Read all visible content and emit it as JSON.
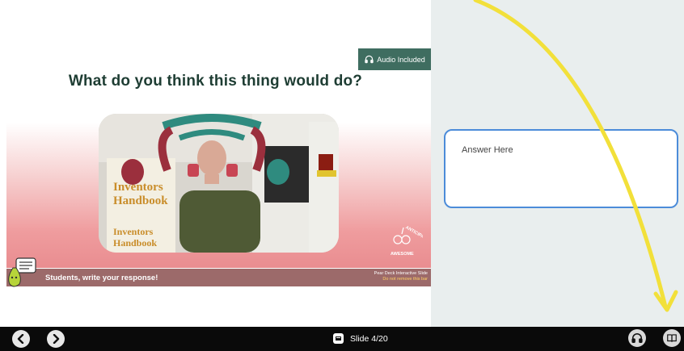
{
  "slide": {
    "audio_badge": "Audio Included",
    "title": "What do you think this thing would do?",
    "footer_text": "Students, write your response!",
    "peardeck_label": "Pear Deck Interactive Slide",
    "peardeck_sublabel": "Do not remove this bar",
    "stamp_text_top": "ANTICIPATE",
    "stamp_text_bottom": "AWESOME"
  },
  "answer": {
    "placeholder": "Answer Here"
  },
  "bottom_bar": {
    "slide_label": "Slide 4/20"
  },
  "colors": {
    "accent_green": "#3f6d60",
    "title_green": "#1e3d33",
    "answer_border": "#4c8cd9",
    "arrow_yellow": "#f2e03a",
    "footer_bar": "#9c6a6a"
  },
  "icons": {
    "audio": "headphones-icon",
    "prev": "chevron-left-icon",
    "next": "chevron-right-icon",
    "slides": "slide-deck-icon",
    "audio_button": "headphones-icon",
    "book": "immersive-reader-icon"
  }
}
